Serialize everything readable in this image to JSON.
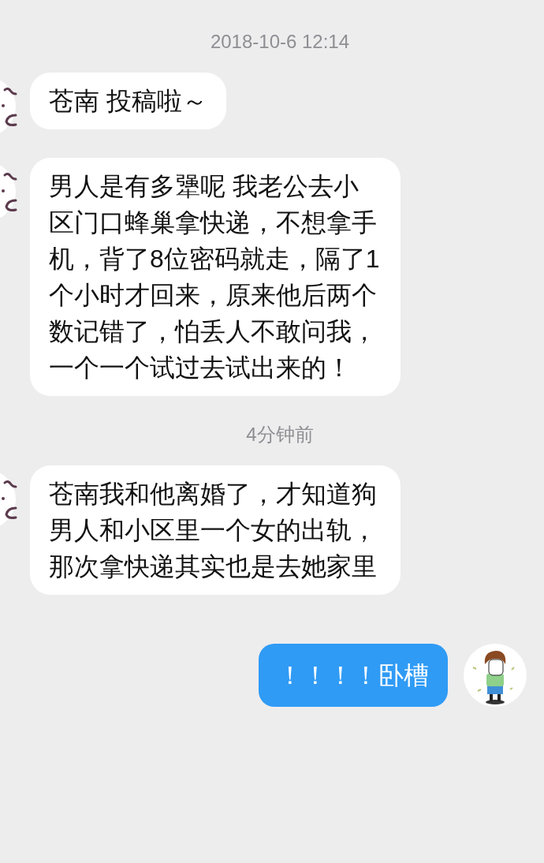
{
  "items": [
    {
      "kind": "time",
      "text": "2018-10-6 12:14"
    },
    {
      "kind": "received",
      "text": "苍南 投稿啦～"
    },
    {
      "kind": "received",
      "text": "男人是有多犟呢 我老公去小区门口蜂巢拿快递，不想拿手机，背了8位密码就走，隔了1个小时才回来，原来他后两个数记错了，怕丢人不敢问我，一个一个试过去试出来的！"
    },
    {
      "kind": "time",
      "text": "4分钟前"
    },
    {
      "kind": "received",
      "text": "苍南我和他离婚了，才知道狗男人和小区里一个女的出轨，那次拿快递其实也是去她家里"
    },
    {
      "kind": "sent",
      "text": "！！！！卧槽"
    }
  ]
}
